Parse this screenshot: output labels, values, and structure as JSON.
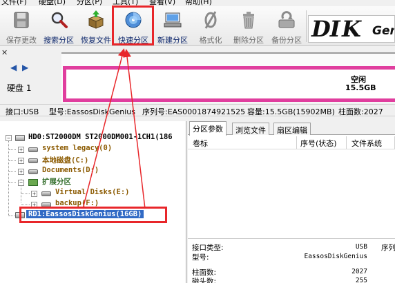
{
  "menu": [
    "文件(F)",
    "硬盘(D)",
    "分区(P)",
    "工具(T)",
    "查看(V)",
    "帮助(H)"
  ],
  "toolbar": {
    "save": "保存更改",
    "search": "搜索分区",
    "recover": "恢复文件",
    "quick_partition": "快速分区",
    "new_partition": "新建分区",
    "format": "格式化",
    "delete_partition": "删除分区",
    "backup_partition": "备份分区"
  },
  "logo": {
    "part1": "DI",
    "part2": "K",
    "part3": "Gen"
  },
  "disk_overview": {
    "disk_label": "硬盘 1",
    "free_label": "空闲",
    "free_size": "15.5GB"
  },
  "info_line": {
    "interface": "接口:USB",
    "model": "型号:EassosDiskGenius",
    "serial": "序列号:EAS0001874921525",
    "capacity": "容量:15.5GB(15902MB)",
    "cylinders": "柱面数:2027"
  },
  "tree": {
    "hd0": "HD0:ST2000DM ST2000DM001-1CH1(186",
    "system_legacy": "system legacy(0)",
    "local_disk": "本地磁盘(C:)",
    "documents": "Documents(D:)",
    "extended": "扩展分区",
    "virtual_disks": "Virtual Disks(E:)",
    "backup": "backup(F:)",
    "rd1": "RD1:EassosDiskGenius(16GB)"
  },
  "right_panel": {
    "tabs": [
      "分区参数",
      "浏览文件",
      "扇区编辑"
    ],
    "columns": [
      "卷标",
      "序号(状态)",
      "文件系统"
    ],
    "details": {
      "interface_type_label": "接口类型:",
      "interface_type_value": "USB",
      "model_label": "型号:",
      "model_value": "EassosDiskGenius",
      "serial_label": "序列",
      "cylinders_label": "柱面数:",
      "cylinders_value": "2027",
      "heads_label": "磁头数:",
      "heads_value": "255"
    }
  },
  "colors": {
    "highlight": "#e8262a",
    "selection": "#316ac5",
    "partition_border": "#e03e9e",
    "tree_label": "#8b5a00"
  }
}
